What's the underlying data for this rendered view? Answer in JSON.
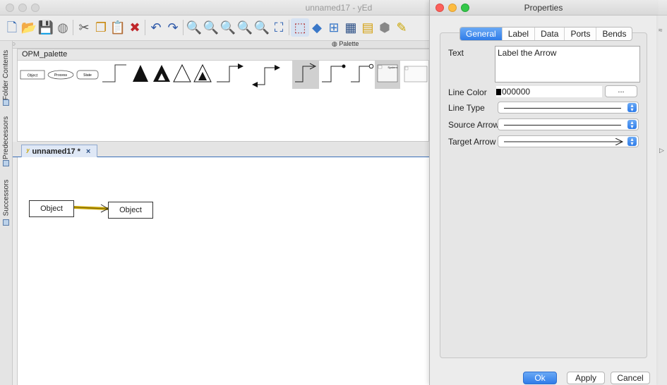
{
  "main_window": {
    "title": "unnamed17 - yEd",
    "palette_title": "Palette",
    "palette_section": "OPM_palette",
    "left_tabs": [
      "Folder Contents",
      "Predecessors",
      "Successors"
    ],
    "document_tab": "unnamed17 *",
    "document_tab_close": "×",
    "palette_items": {
      "object": "Object",
      "process": "Process",
      "state": "State",
      "system": "System"
    },
    "nodes": {
      "source": "Object",
      "target": "Object"
    }
  },
  "properties": {
    "title": "Properties",
    "tabs": [
      "General",
      "Label",
      "Data",
      "Ports",
      "Bends"
    ],
    "active_tab": "General",
    "fields": {
      "text_label": "Text",
      "text_value": "Label the Arrow",
      "line_color_label": "Line Color",
      "line_color_value": "000000",
      "more_button": "...",
      "line_type_label": "Line Type",
      "source_arrow_label": "Source Arrow",
      "target_arrow_label": "Target Arrow"
    },
    "buttons": {
      "ok": "Ok",
      "apply": "Apply",
      "cancel": "Cancel"
    }
  },
  "colors": {
    "accent": "#2f7ce9",
    "edge": "#c9a400"
  },
  "icons": {
    "toolbar": [
      "new-document-icon",
      "open-folder-icon",
      "save-icon",
      "cube-icon",
      "cut-icon",
      "copy-icon",
      "paste-icon",
      "delete-icon",
      "undo-icon",
      "redo-icon",
      "zoom-in-icon",
      "zoom-out-icon",
      "zoom-fit-icon",
      "zoom-area-icon",
      "zoom-selection-icon",
      "fit-content-icon",
      "edit-mode-icon",
      "layout-icon",
      "snap-icon",
      "grid-icon",
      "palette-icon",
      "settings-icon",
      "plugin-icon"
    ]
  }
}
